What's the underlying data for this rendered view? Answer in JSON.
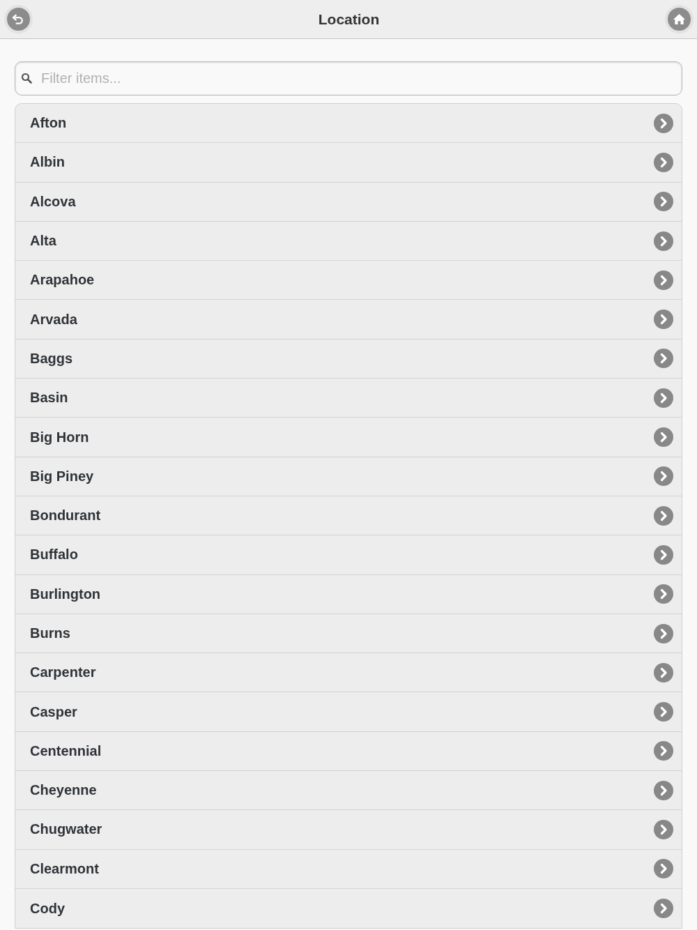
{
  "header": {
    "title": "Location"
  },
  "search": {
    "placeholder": "Filter items..."
  },
  "items": [
    {
      "label": "Afton"
    },
    {
      "label": "Albin"
    },
    {
      "label": "Alcova"
    },
    {
      "label": "Alta"
    },
    {
      "label": "Arapahoe"
    },
    {
      "label": "Arvada"
    },
    {
      "label": "Baggs"
    },
    {
      "label": "Basin"
    },
    {
      "label": "Big Horn"
    },
    {
      "label": "Big Piney"
    },
    {
      "label": "Bondurant"
    },
    {
      "label": "Buffalo"
    },
    {
      "label": "Burlington"
    },
    {
      "label": "Burns"
    },
    {
      "label": "Carpenter"
    },
    {
      "label": "Casper"
    },
    {
      "label": "Centennial"
    },
    {
      "label": "Cheyenne"
    },
    {
      "label": "Chugwater"
    },
    {
      "label": "Clearmont"
    },
    {
      "label": "Cody"
    }
  ]
}
